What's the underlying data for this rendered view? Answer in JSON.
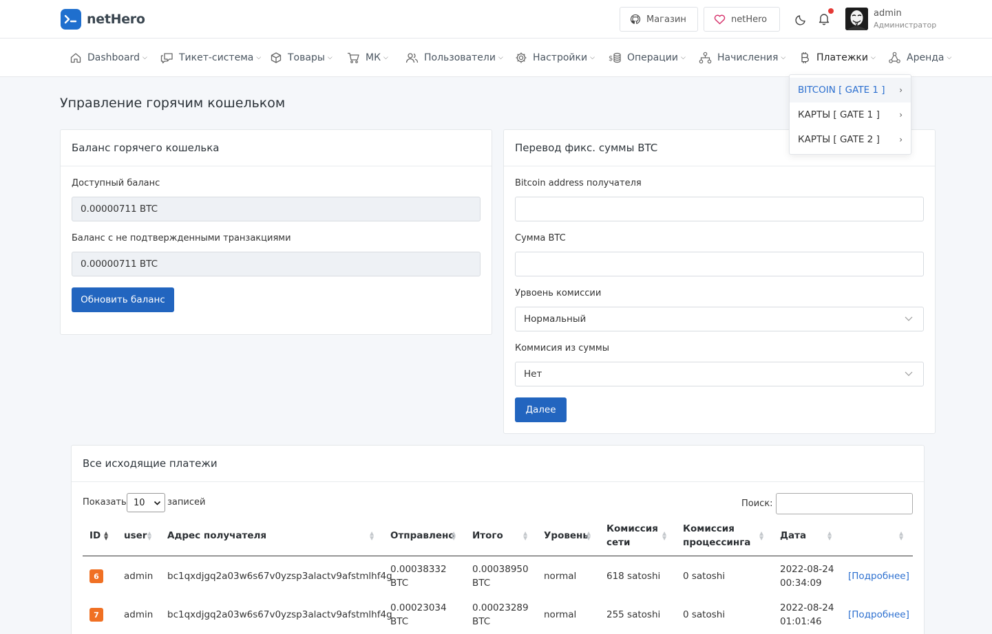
{
  "app": {
    "name": "netHero"
  },
  "header": {
    "shop_label": "Магазин",
    "hero_label": "netHero",
    "user": {
      "name": "admin",
      "role": "Администратор"
    }
  },
  "nav": [
    {
      "label": "Dashboard",
      "icon": "home-icon"
    },
    {
      "label": "Тикет-система",
      "icon": "chat-icon"
    },
    {
      "label": "Товары",
      "icon": "box-icon"
    },
    {
      "label": "МК",
      "icon": "cart-icon"
    },
    {
      "label": "Пользователи",
      "icon": "users-icon"
    },
    {
      "label": "Настройки",
      "icon": "gear-icon"
    },
    {
      "label": "Операции",
      "icon": "coins-icon"
    },
    {
      "label": "Начисления",
      "icon": "sitemap-icon"
    },
    {
      "label": "Платежки",
      "icon": "bitcoin-icon"
    },
    {
      "label": "Аренда",
      "icon": "rent-icon"
    }
  ],
  "dropdown": [
    {
      "label": "BITCOIN [ GATE 1 ]"
    },
    {
      "label": "КАРТЫ [ GATE 1 ]"
    },
    {
      "label": "КАРТЫ [ GATE 2 ]"
    }
  ],
  "page": {
    "title": "Управление горячим кошельком"
  },
  "balance_card": {
    "title": "Баланс горячего кошелька",
    "available_label": "Доступный баланс",
    "available_value": "0.00000711 BTC",
    "unconfirmed_label": "Баланс с не подтвержденными транзакциями",
    "unconfirmed_value": "0.00000711 BTC",
    "refresh_button": "Обновить баланс"
  },
  "transfer_card": {
    "title": "Перевод фикс. суммы BTC",
    "address_label": "Bitcoin address получателя",
    "amount_label": "Сумма BTC",
    "fee_level_label": "Урвоень комиссии",
    "fee_level_value": "Нормальный",
    "fee_from_amount_label": "Коммисия из суммы",
    "fee_from_amount_value": "Нет",
    "next_button": "Далее"
  },
  "payments": {
    "title": "Все исходящие платежи",
    "show_prefix": "Показать",
    "show_value": "10",
    "show_suffix": "записей",
    "search_label": "Поиск:",
    "columns": [
      "ID",
      "user",
      "Адрес получателя",
      "Отправлено",
      "Итого",
      "Уровень",
      "Комиссия сети",
      "Комиссия процессинга",
      "Дата",
      ""
    ],
    "rows": [
      {
        "id": "6",
        "user": "admin",
        "address": "bc1qxdjgq2a03w6s67v0yzsp3alactv9afstmlhf4g",
        "sent": "0.00038332",
        "sent_unit": "BTC",
        "total": "0.00038950",
        "total_unit": "BTC",
        "level": "normal",
        "net_fee": "618 satoshi",
        "proc_fee": "0 satoshi",
        "date": "2022-08-24",
        "time": "00:34:09",
        "more": "[Подробнее]"
      },
      {
        "id": "7",
        "user": "admin",
        "address": "bc1qxdjgq2a03w6s67v0yzsp3alactv9afstmlhf4g",
        "sent": "0.00023034",
        "sent_unit": "BTC",
        "total": "0.00023289",
        "total_unit": "BTC",
        "level": "normal",
        "net_fee": "255 satoshi",
        "proc_fee": "0 satoshi",
        "date": "2022-08-24",
        "time": "01:01:46",
        "more": "[Подробнее]"
      }
    ]
  },
  "colors": {
    "primary": "#2265bf",
    "badge": "#f07023",
    "link": "#2a6ecf"
  }
}
